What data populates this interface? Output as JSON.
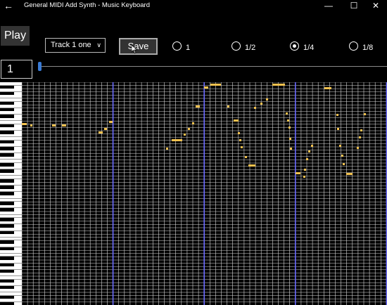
{
  "titlebar": {
    "back_icon": "back-arrow-icon",
    "title": "General MIDI Add Synth - Music Keyboard",
    "minimize_icon": "minimize-icon",
    "maximize_icon": "maximize-icon",
    "close_icon": "close-icon"
  },
  "toolbar": {
    "play_label": "Play",
    "track_value": "Track 1  one",
    "save_label": "Save",
    "radios": [
      {
        "label": "1",
        "selected": false
      },
      {
        "label": "1/2",
        "selected": false
      },
      {
        "label": "1/4",
        "selected": true
      },
      {
        "label": "1/8",
        "selected": false
      }
    ]
  },
  "position": {
    "measure_value": "1",
    "slider_value": 0
  },
  "colors": {
    "background": "#000000",
    "grid": "#d8d8d8",
    "measure_line": "#6a6aff",
    "note": "#f2c14e"
  }
}
